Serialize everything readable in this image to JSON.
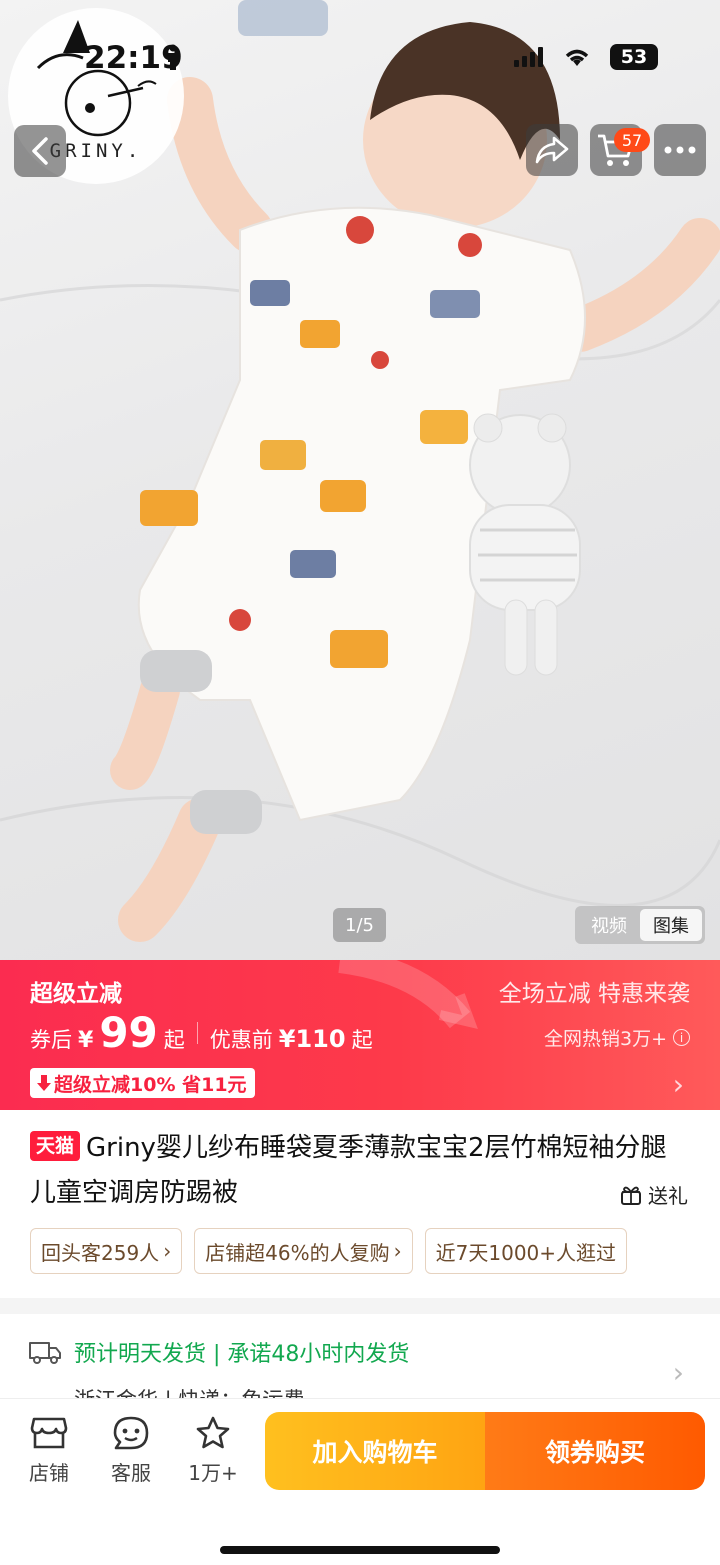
{
  "status_bar": {
    "time": "22:19",
    "battery": "53"
  },
  "brand": {
    "logo_text": "GRINY."
  },
  "header": {
    "cart_count": "57"
  },
  "gallery": {
    "counter": "1/5",
    "tabs": [
      {
        "label": "视频"
      },
      {
        "label": "图集"
      }
    ]
  },
  "promo": {
    "title": "超级立减",
    "coupon_prefix": "券后",
    "currency": "¥",
    "price": "99",
    "price_suffix": "起",
    "before_label": "优惠前",
    "before_price": "¥110",
    "before_suffix": "起",
    "tag": "超级立减10% 省11元",
    "right_line1": "全场立减 特惠来袭",
    "right_line2": "全网热销3万+"
  },
  "product": {
    "platform_badge": "天猫",
    "title": "Griny婴儿纱布睡袋夏季薄款宝宝2层竹棉短袖分腿儿童空调房防踢被",
    "gift_label": "送礼",
    "chips": [
      {
        "label": "回头客259人"
      },
      {
        "label": "店铺超46%的人复购"
      },
      {
        "label": "近7天1000+人逛过"
      }
    ]
  },
  "delivery": {
    "text": "预计明天发货 | 承诺48小时内发货",
    "sub": "浙江金华 | 快递：免运费"
  },
  "bottom_bar": {
    "store_label": "店铺",
    "service_label": "客服",
    "fav_label": "1万+",
    "add_cart_label": "加入购物车",
    "buy_label": "领券购买"
  }
}
